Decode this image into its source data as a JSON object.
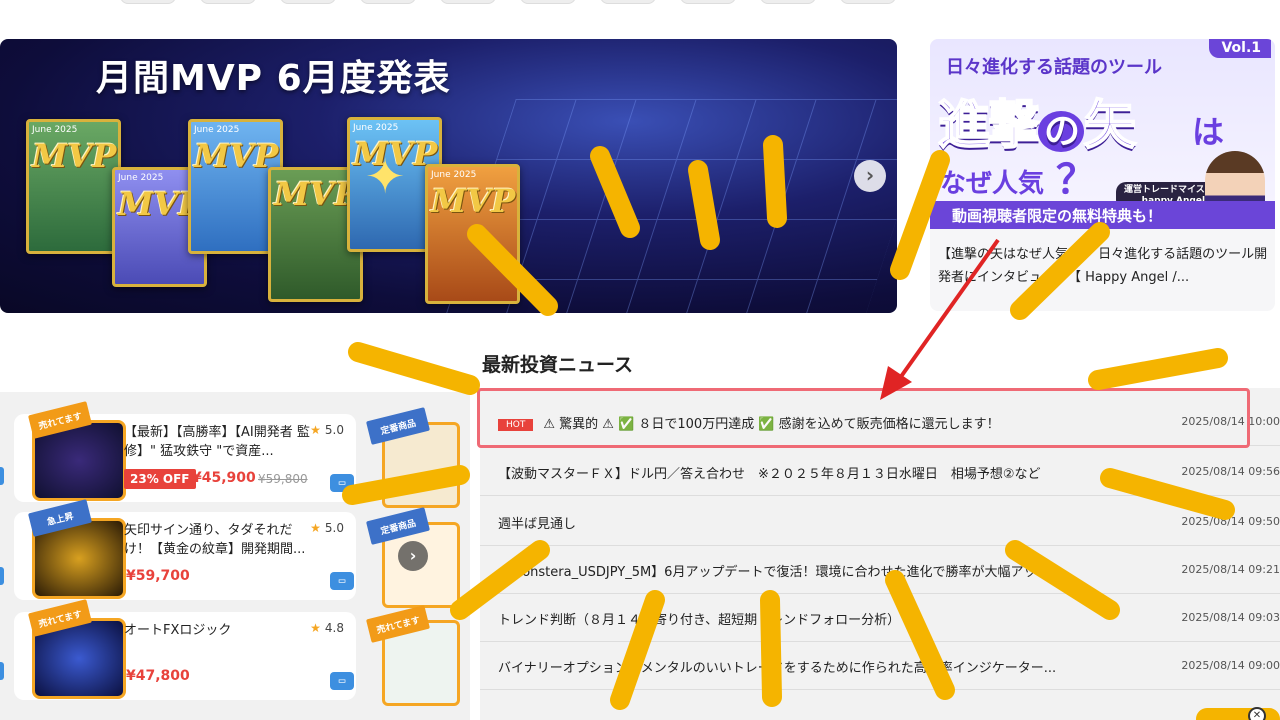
{
  "hero": {
    "title": "月間MVP 6月度発表",
    "cards": [
      {
        "date": "June 2025",
        "mvp": "MVP"
      },
      {
        "date": "June 2025",
        "mvp": "MVP"
      },
      {
        "date": "June 2025",
        "mvp": "MVP"
      },
      {
        "date": "",
        "mvp": "MVP"
      },
      {
        "date": "June 2025",
        "mvp": "MVP"
      },
      {
        "date": "June 2025",
        "mvp": "MVP"
      }
    ],
    "next_icon": "chevron-right-icon",
    "next_glyph": "›"
  },
  "promo": {
    "vol": "Vol.1",
    "subtitle": "日々進化する話題のツール",
    "headline_a": "進撃",
    "headline_no": "の",
    "headline_b": "矢",
    "headline_ha": "は",
    "naze": "なぜ人気",
    "question": "？",
    "badge_role": "運営トレードマイスター",
    "badge_name": "happy Angel",
    "strip": "動画視聴者限定の無料特典も！",
    "caption": "【進撃の矢はなぜ人気？】 日々進化する話題のツール開発者にインタビュー！【 Happy Angel /..."
  },
  "products": [
    {
      "ribbon": "売れてます",
      "title": "【最新】【高勝率】【AI開発者 監修】\" 猛攻鉄守 \"で資産...",
      "rating": "5.0",
      "discount": "23% OFF",
      "price": "¥45,900",
      "old_price": "¥59,800"
    },
    {
      "ribbon": "急上昇",
      "title": "矢印サイン通り、タダそれだけ！【黄金の紋章】開発期間...",
      "rating": "5.0",
      "discount": "",
      "price": "¥59,700",
      "old_price": ""
    },
    {
      "ribbon": "売れてます",
      "title": "オートFXロジック",
      "rating": "4.8",
      "discount": "",
      "price": "¥47,800",
      "old_price": ""
    }
  ],
  "side_tiles": [
    {
      "ribbon": "定番商品"
    },
    {
      "ribbon": "定番商品"
    },
    {
      "ribbon": "売れてます"
    }
  ],
  "carousel_glyph": "›",
  "news": {
    "heading": "最新投資ニュース",
    "items": [
      {
        "hot": "HOT",
        "title": "⚠ 驚異的 ⚠ ✅ ８日で100万円達成 ✅ 感謝を込めて販売価格に還元します！",
        "date": "2025/08/14 10:00"
      },
      {
        "hot": "",
        "title": "【波動マスターＦＸ】ドル円／答え合わせ　※２０２５年８月１３日水曜日　相場予想②など",
        "date": "2025/08/14 09:56"
      },
      {
        "hot": "",
        "title": "週半ば見通し",
        "date": "2025/08/14 09:50"
      },
      {
        "hot": "",
        "title": "【Monstera_USDJPY_5M】6月アップデートで復活！環境に合わせた進化で勝率が大幅アップ",
        "date": "2025/08/14 09:21"
      },
      {
        "hot": "",
        "title": "トレンド判断（８月１４日寄り付き、超短期トレンドフォロー分析）",
        "date": "2025/08/14 09:03"
      },
      {
        "hot": "",
        "title": "バイナリーオプションでメンタルのいいトレードをするために作られた高勝率インジケーター...",
        "date": "2025/08/14 09:00"
      }
    ]
  },
  "colors": {
    "accent_red": "#e8423b",
    "highlight_border": "#ef6a75",
    "annotation_yellow": "#f5b400",
    "arrow_red": "#e02424",
    "promo_purple": "#6b45d8"
  },
  "icons": [
    "chevron-right-icon",
    "star-icon",
    "cart-icon",
    "warning-icon",
    "check-icon",
    "close-icon",
    "sparkle-icon"
  ]
}
